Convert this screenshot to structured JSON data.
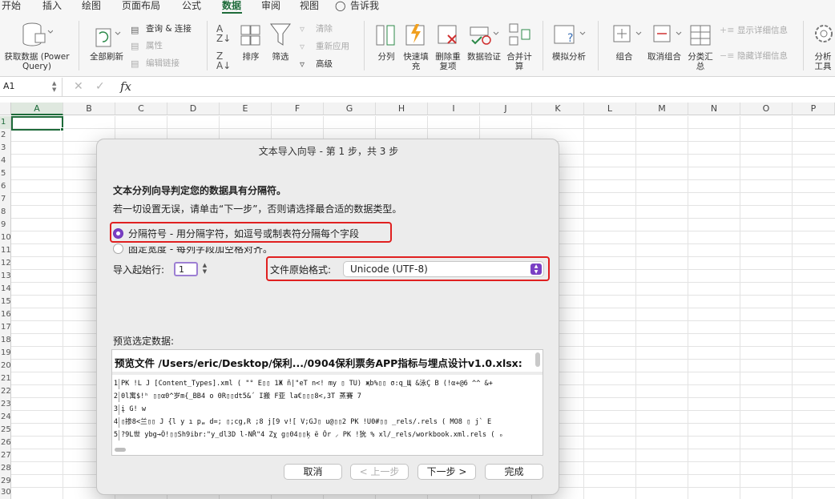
{
  "ribbon_tabs": [
    {
      "label": "开始"
    },
    {
      "label": "插入"
    },
    {
      "label": "绘图"
    },
    {
      "label": "页面布局"
    },
    {
      "label": "公式"
    },
    {
      "label": "数据"
    },
    {
      "label": "审阅"
    },
    {
      "label": "视图"
    },
    {
      "label": "告诉我"
    }
  ],
  "ribbon": {
    "get_data": "获取数据 (Power Query)",
    "refresh_all": "全部刷新",
    "queries_connections": "查询 & 连接",
    "properties": "属性",
    "edit_links": "编辑链接",
    "sort": "排序",
    "filter": "筛选",
    "clear": "清除",
    "reapply": "重新应用",
    "advanced": "高级",
    "text_to_columns": "分列",
    "flash_fill": "快速填充",
    "remove_duplicates": "删除重复项",
    "data_validation": "数据验证",
    "consolidate": "合并计算",
    "what_if": "模拟分析",
    "group": "组合",
    "ungroup": "取消组合",
    "subtotal": "分类汇总",
    "show_detail": "显示详细信息",
    "hide_detail": "隐藏详细信息",
    "analysis_tools": "分析工具"
  },
  "formula_bar": {
    "name_box": "A1",
    "fx": "fx",
    "value": ""
  },
  "columns": [
    "A",
    "B",
    "C",
    "D",
    "E",
    "F",
    "G",
    "H",
    "I",
    "J",
    "K",
    "L",
    "M",
    "N",
    "O",
    "P"
  ],
  "rows": [
    "1",
    "2",
    "3",
    "4",
    "5",
    "6",
    "7",
    "8",
    "9",
    "10",
    "11",
    "12",
    "13",
    "14",
    "15",
    "16",
    "17",
    "18",
    "19",
    "20",
    "21",
    "22",
    "23",
    "24",
    "25",
    "26",
    "27",
    "28",
    "29",
    "30"
  ],
  "dialog": {
    "title": "文本导入向导 - 第 1 步，共 3 步",
    "heading": "文本分列向导判定您的数据具有分隔符。",
    "instruction": "若一切设置无误，请单击“下一步”，否则请选择最合适的数据类型。",
    "option_delimited": "分隔符号  - 用分隔字符，如逗号或制表符分隔每个字段",
    "option_fixed": "固定宽度  - 每列字段加空格对齐。",
    "start_row_label": "导入起始行:",
    "start_row_value": "1",
    "file_origin_label": "文件原始格式:",
    "file_origin_value": "Unicode (UTF-8)",
    "preview_label": "预览选定数据:",
    "preview_title": "预览文件 /Users/eric/Desktop/保利.../0904保利票务APP指标与埋点设计v1.0.xlsx:",
    "preview_rows": [
      {
        "num": "1",
        "text": "PK     !L  J   [Content_Types].xml   (  \"°  E▯▯ 1Ж ñ|\"eT n<! my ▯ TU) җb%▯▯  σ:q_Щ &泳Ç B (!α+@6 ^^ &+"
      },
      {
        "num": "2",
        "text": "0l寓$!ʰ ▯▯α0^岁m{_BB4 ο 0R▯▯dt5&´  I搬 F亚 lа€▯▯▯8<,3T 蒸賽 7"
      },
      {
        "num": "3",
        "text": "į G! w"
      },
      {
        "num": "4",
        "text": "▯掺8<兰▯▯    J {l y ı  p„ d=; ▯;cg,R ;8 j[9 v![ V;GJ▯  u@▯▯2  PK     !U0#▯▯  _rels/.rels   ( MO8  ▯ j` E"
      },
      {
        "num": "5",
        "text": "?9L世 ybg→Ȍ!▯▯Sh9ibr:\"y_dl3D l-NŘ\"4 Zχ g▯04▯▯ķ ë Ŏr ⸝ PK     !狁 %    xl/_rels/workbook.xml.rels   ( ₒ"
      }
    ],
    "buttons": {
      "cancel": "取消",
      "back": "< 上一步",
      "next": "下一步 >",
      "finish": "完成"
    }
  },
  "colors": {
    "accent": "#1e6b3a",
    "radio": "#7a3fc4",
    "highlight": "#e02020"
  }
}
